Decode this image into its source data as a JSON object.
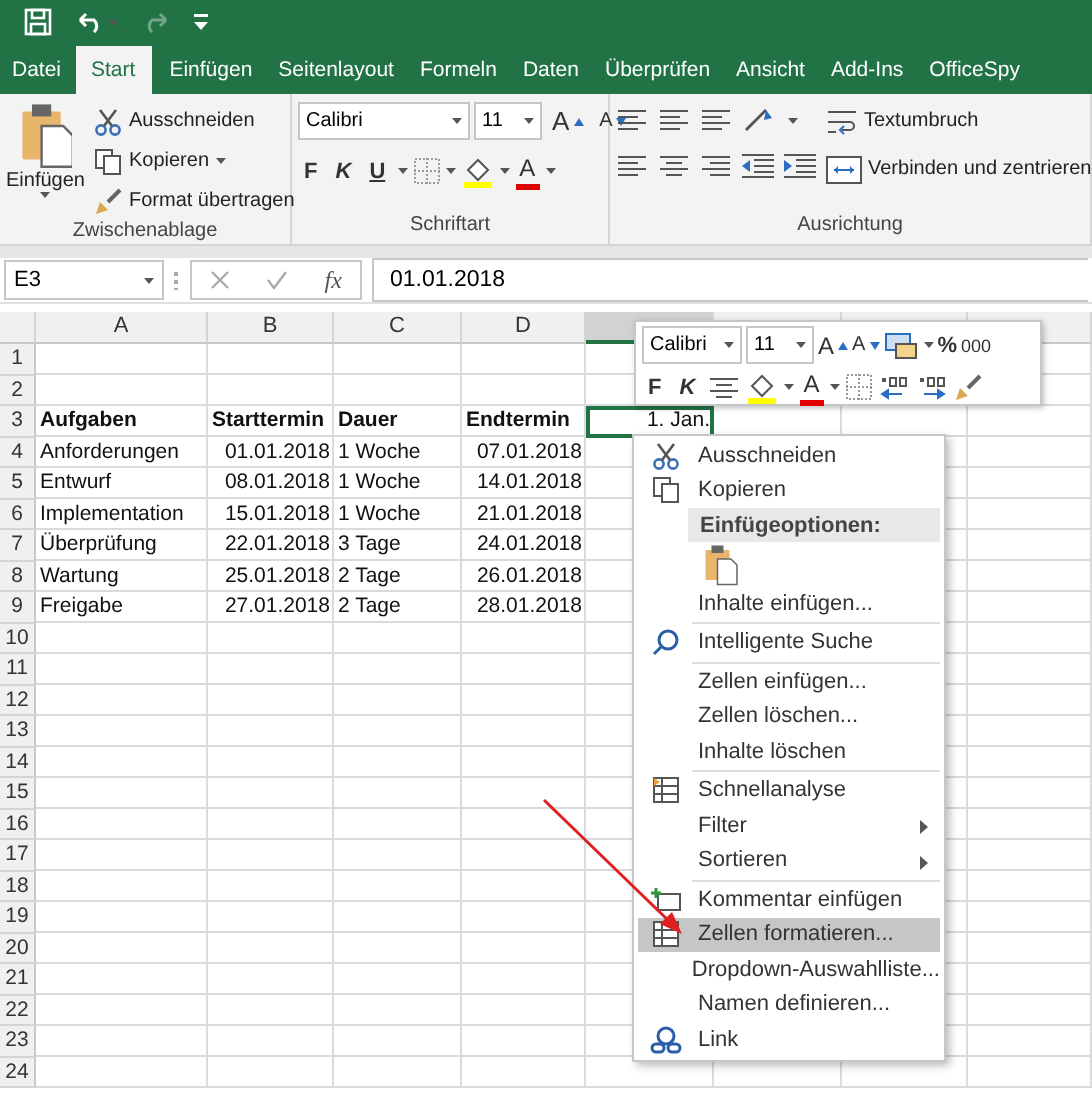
{
  "tabs": [
    {
      "label": "Datei",
      "selected": false
    },
    {
      "label": "Start",
      "selected": true
    },
    {
      "label": "Einfügen",
      "selected": false
    },
    {
      "label": "Seitenlayout",
      "selected": false
    },
    {
      "label": "Formeln",
      "selected": false
    },
    {
      "label": "Daten",
      "selected": false
    },
    {
      "label": "Überprüfen",
      "selected": false
    },
    {
      "label": "Ansicht",
      "selected": false
    },
    {
      "label": "Add-Ins",
      "selected": false
    },
    {
      "label": "OfficeSpy",
      "selected": false
    }
  ],
  "ribbon": {
    "clipboard": {
      "paste_label": "Einfügen",
      "items": [
        "Ausschneiden",
        "Kopieren",
        "Format übertragen"
      ],
      "group_label": "Zwischenablage"
    },
    "font": {
      "font_name": "Calibri",
      "font_size": "11",
      "grow_label": "A",
      "shrink_label": "A",
      "bold_label": "F",
      "italic_label": "K",
      "underline_label": "U",
      "font_color_label": "A",
      "group_label": "Schriftart"
    },
    "alignment": {
      "wrap_label": "Textumbruch",
      "merge_label": "Verbinden und zentrieren",
      "group_label": "Ausrichtung"
    }
  },
  "formula_bar": {
    "name_box": "E3",
    "function_label": "fx",
    "value": "01.01.2018"
  },
  "sheet": {
    "columns": [
      "A",
      "B",
      "C",
      "D"
    ],
    "rows": [
      {
        "number": "1"
      },
      {
        "number": "2"
      },
      {
        "number": "3",
        "kind": "header",
        "cells": [
          {
            "text": "Aufgaben"
          },
          {
            "text": "Starttermin"
          },
          {
            "text": "Dauer"
          },
          {
            "text": "Endtermin"
          },
          {
            "text": "1. Jan.",
            "numeric": true,
            "selected": true
          }
        ]
      },
      {
        "number": "4",
        "cells": [
          {
            "text": "Anforderungen"
          },
          {
            "text": "01.01.2018",
            "numeric": true
          },
          {
            "text": "1 Woche"
          },
          {
            "text": "07.01.2018",
            "numeric": true
          }
        ]
      },
      {
        "number": "5",
        "cells": [
          {
            "text": "Entwurf"
          },
          {
            "text": "08.01.2018",
            "numeric": true
          },
          {
            "text": "1 Woche"
          },
          {
            "text": "14.01.2018",
            "numeric": true
          }
        ]
      },
      {
        "number": "6",
        "cells": [
          {
            "text": "Implementation"
          },
          {
            "text": "15.01.2018",
            "numeric": true
          },
          {
            "text": "1 Woche"
          },
          {
            "text": "21.01.2018",
            "numeric": true
          }
        ]
      },
      {
        "number": "7",
        "cells": [
          {
            "text": "Überprüfung"
          },
          {
            "text": "22.01.2018",
            "numeric": true
          },
          {
            "text": "3 Tage"
          },
          {
            "text": "24.01.2018",
            "numeric": true
          }
        ]
      },
      {
        "number": "8",
        "cells": [
          {
            "text": "Wartung"
          },
          {
            "text": "25.01.2018",
            "numeric": true
          },
          {
            "text": "2 Tage"
          },
          {
            "text": "26.01.2018",
            "numeric": true
          }
        ]
      },
      {
        "number": "9",
        "cells": [
          {
            "text": "Freigabe"
          },
          {
            "text": "27.01.2018",
            "numeric": true
          },
          {
            "text": "2 Tage"
          },
          {
            "text": "28.01.2018",
            "numeric": true
          }
        ]
      },
      {
        "number": "10"
      },
      {
        "number": "11"
      },
      {
        "number": "12"
      },
      {
        "number": "13"
      },
      {
        "number": "14"
      },
      {
        "number": "15"
      },
      {
        "number": "16"
      },
      {
        "number": "17"
      },
      {
        "number": "18"
      },
      {
        "number": "19"
      },
      {
        "number": "20"
      },
      {
        "number": "21"
      },
      {
        "number": "22"
      },
      {
        "number": "23"
      },
      {
        "number": "24"
      }
    ]
  },
  "mini_toolbar": {
    "font_name": "Calibri",
    "font_size": "11",
    "grow_label": "A",
    "shrink_label": "A",
    "percent_label": "%",
    "thousands_label": "000",
    "bold_label": "F",
    "italic_label": "K",
    "font_color_label": "A"
  },
  "context_menu": {
    "items": [
      {
        "kind": "item",
        "label": "Ausschneiden",
        "selected": false
      },
      {
        "kind": "item",
        "label": "Kopieren",
        "selected": false
      },
      {
        "kind": "header",
        "label": "Einfügeoptionen:"
      },
      {
        "kind": "paste"
      },
      {
        "kind": "item",
        "label": "Inhalte einfügen...",
        "selected": false
      },
      {
        "kind": "separator"
      },
      {
        "kind": "item",
        "label": "Intelligente Suche",
        "selected": false
      },
      {
        "kind": "separator"
      },
      {
        "kind": "item",
        "label": "Zellen einfügen...",
        "selected": false
      },
      {
        "kind": "item",
        "label": "Zellen löschen...",
        "selected": false
      },
      {
        "kind": "item",
        "label": "Inhalte löschen",
        "selected": false
      },
      {
        "kind": "separator"
      },
      {
        "kind": "item",
        "label": "Schnellanalyse",
        "selected": false
      },
      {
        "kind": "item",
        "label": "Filter",
        "selected": false,
        "submenu": true
      },
      {
        "kind": "item",
        "label": "Sortieren",
        "selected": false,
        "submenu": true
      },
      {
        "kind": "separator"
      },
      {
        "kind": "item",
        "label": "Kommentar einfügen",
        "selected": false
      },
      {
        "kind": "item",
        "label": "Zellen formatieren...",
        "selected": true
      },
      {
        "kind": "item",
        "label": "Dropdown-Auswahlliste...",
        "selected": false
      },
      {
        "kind": "item",
        "label": "Namen definieren...",
        "selected": false
      },
      {
        "kind": "item",
        "label": "Link",
        "selected": false
      }
    ]
  }
}
